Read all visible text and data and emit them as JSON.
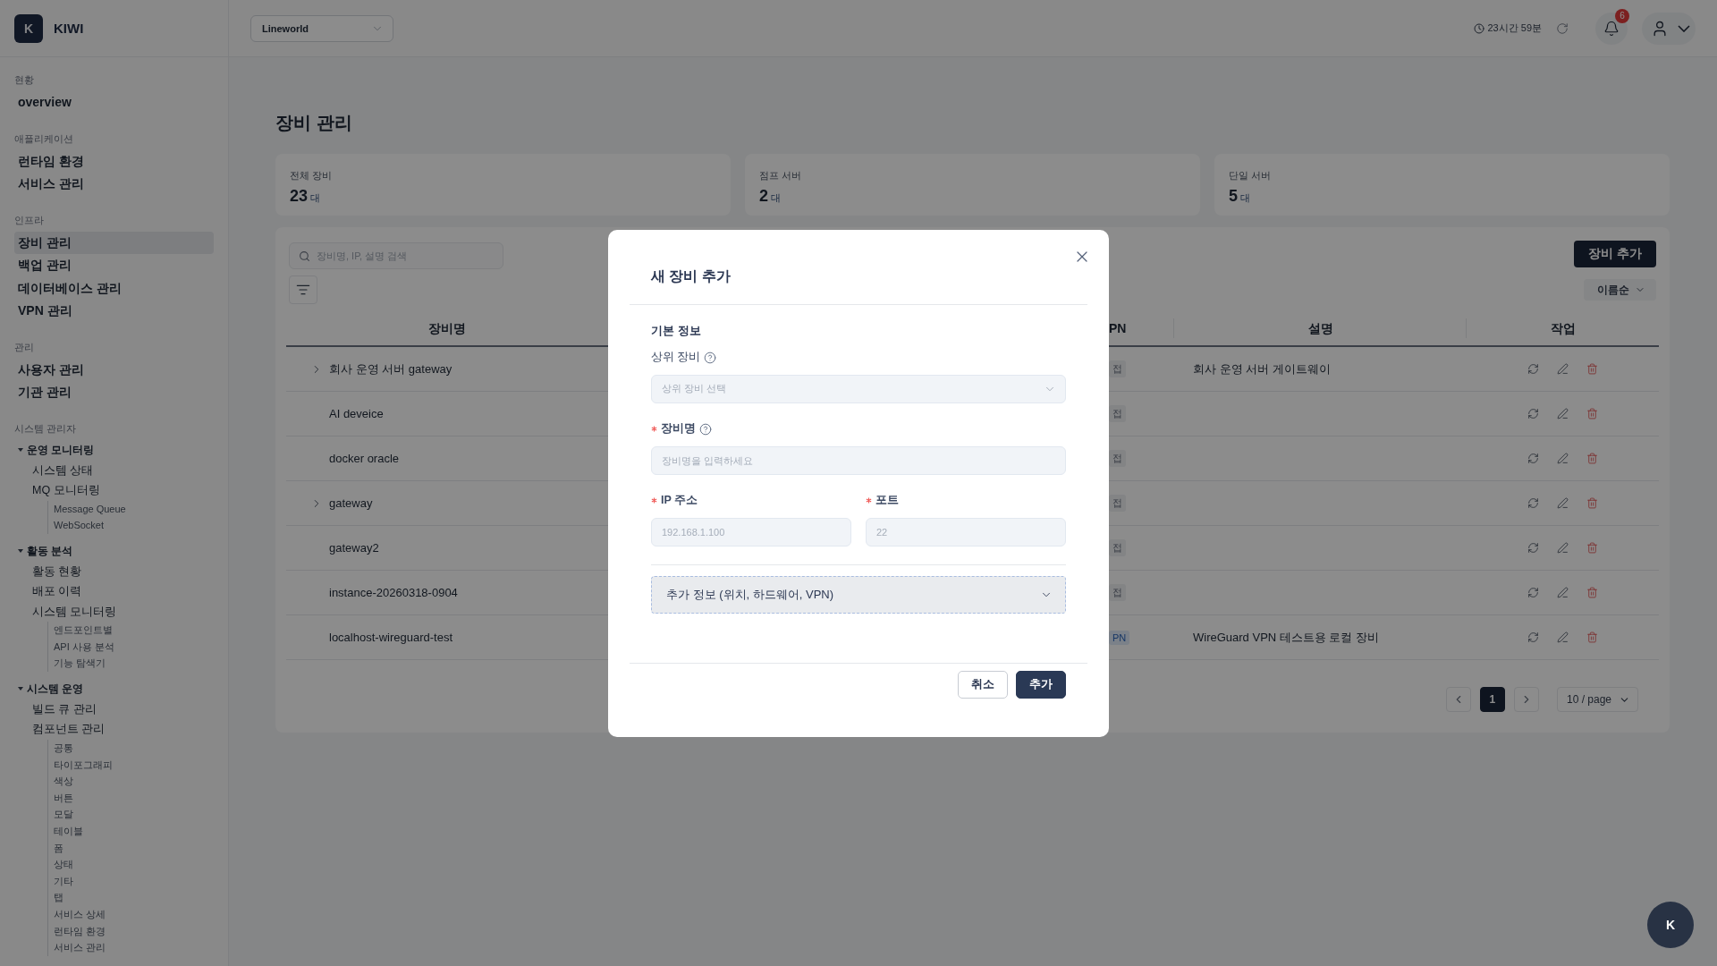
{
  "sidebar": {
    "logo_mark": "K",
    "brand": "KIWI",
    "sections": [
      {
        "title": "현황",
        "items": [
          {
            "label": "overview",
            "selected": false
          }
        ]
      },
      {
        "title": "애플리케이션",
        "items": [
          {
            "label": "런타임 환경",
            "selected": false
          },
          {
            "label": "서비스 관리",
            "selected": false
          }
        ]
      },
      {
        "title": "인프라",
        "items": [
          {
            "label": "장비 관리",
            "selected": true
          },
          {
            "label": "백업 관리",
            "selected": false
          },
          {
            "label": "데이터베이스 관리",
            "selected": false
          },
          {
            "label": "VPN 관리",
            "selected": false
          }
        ]
      },
      {
        "title": "관리",
        "items": [
          {
            "label": "사용자 관리",
            "selected": false
          },
          {
            "label": "기관 관리",
            "selected": false
          }
        ]
      },
      {
        "title": "시스템 관리자",
        "items": [
          {
            "label": "운영 모니터링",
            "selected": false,
            "expanded": true,
            "children": [
              {
                "label": "시스템 상태",
                "selected": false
              },
              {
                "label": "MQ 모니터링",
                "selected": false,
                "children": [
                  {
                    "label": "Message Queue",
                    "selected": false
                  },
                  {
                    "label": "WebSocket",
                    "selected": false
                  }
                ]
              }
            ]
          },
          {
            "label": "활동 분석",
            "selected": false,
            "expanded": true,
            "children": [
              {
                "label": "활동 현황",
                "selected": false
              },
              {
                "label": "배포 이력",
                "selected": false
              },
              {
                "label": "시스템 모니터링",
                "selected": false,
                "children": [
                  {
                    "label": "엔드포인트별",
                    "selected": false
                  },
                  {
                    "label": "API 사용 분석",
                    "selected": false
                  },
                  {
                    "label": "기능 탐색기",
                    "selected": false
                  }
                ]
              }
            ]
          },
          {
            "label": "시스템 운영",
            "selected": false,
            "expanded": true,
            "children": [
              {
                "label": "빌드 큐 관리",
                "selected": false
              },
              {
                "label": "컴포넌트 관리",
                "selected": false,
                "children": [
                  {
                    "label": "공통",
                    "selected": false
                  },
                  {
                    "label": "타이포그래피",
                    "selected": false
                  },
                  {
                    "label": "색상",
                    "selected": false
                  },
                  {
                    "label": "버튼",
                    "selected": false
                  },
                  {
                    "label": "모달",
                    "selected": false
                  },
                  {
                    "label": "테이블",
                    "selected": false
                  },
                  {
                    "label": "폼",
                    "selected": false
                  },
                  {
                    "label": "상태",
                    "selected": false
                  },
                  {
                    "label": "기타",
                    "selected": false
                  },
                  {
                    "label": "탭",
                    "selected": false
                  },
                  {
                    "label": "서비스 상세",
                    "selected": false
                  },
                  {
                    "label": "런타임 환경",
                    "selected": false
                  },
                  {
                    "label": "서비스 관리",
                    "selected": false
                  }
                ]
              }
            ]
          }
        ]
      }
    ]
  },
  "header": {
    "workspace": "Lineworld",
    "session_time": "23시간 59분",
    "notification_count": "6"
  },
  "page_title": "장비 관리",
  "stats": [
    {
      "label": "전체 장비",
      "value": "23",
      "unit": "대"
    },
    {
      "label": "점프 서버",
      "value": "2",
      "unit": "대"
    },
    {
      "label": "단일 서버",
      "value": "5",
      "unit": "대"
    }
  ],
  "toolbar": {
    "search_placeholder": "장비명, IP, 설명 검색",
    "add_button": "장비 추가",
    "sort": "이름순"
  },
  "table": {
    "columns": [
      "장비명",
      "PN",
      "설명",
      "작업"
    ],
    "rows": [
      {
        "name": "회사 운영 서버 gateway",
        "expandable": true,
        "badge": {
          "text": "접",
          "kind": "plain"
        },
        "description": "회사 운영 서버 게이트웨이"
      },
      {
        "name": "AI deveice",
        "expandable": false,
        "badge": {
          "text": "접",
          "kind": "plain"
        }
      },
      {
        "name": "docker oracle",
        "expandable": false,
        "badge": {
          "text": "접",
          "kind": "plain"
        }
      },
      {
        "name": "gateway",
        "expandable": true,
        "badge": {
          "text": "접",
          "kind": "plain"
        }
      },
      {
        "name": "gateway2",
        "expandable": false,
        "badge": {
          "text": "접",
          "kind": "plain"
        }
      },
      {
        "name": "instance-20260318-0904",
        "expandable": false,
        "badge": {
          "text": "접",
          "kind": "plain"
        }
      },
      {
        "name": "localhost-wireguard-test",
        "expandable": false,
        "badge": {
          "text": "PN",
          "kind": "vpn"
        },
        "description": "WireGuard VPN 테스트용 로컬 장비"
      }
    ]
  },
  "pagination": {
    "pages": [
      {
        "label": "1",
        "selected": true
      }
    ],
    "page_size": "10 / page"
  },
  "modal": {
    "title": "새 장비 추가",
    "section": "기본 정보",
    "rows": [
      [
        {
          "kind": "select",
          "label": "상위 장비",
          "required": false,
          "help": true,
          "placeholder": "상위 장비 선택"
        }
      ],
      [
        {
          "kind": "text",
          "label": "장비명",
          "required": true,
          "help": true,
          "placeholder": "장비명을 입력하세요"
        }
      ],
      [
        {
          "kind": "text",
          "label": "IP 주소",
          "required": true,
          "help": false,
          "placeholder": "192.168.1.100"
        },
        {
          "kind": "text",
          "label": "포트",
          "required": true,
          "help": false,
          "placeholder": "22"
        }
      ]
    ],
    "extra": {
      "label": "추가 정보 (위치, 하드웨어, VPN)",
      "expanded": false
    },
    "buttons": [
      {
        "label": "취소",
        "kind": "secondary"
      },
      {
        "label": "추가",
        "kind": "primary"
      }
    ]
  },
  "fab": "K"
}
